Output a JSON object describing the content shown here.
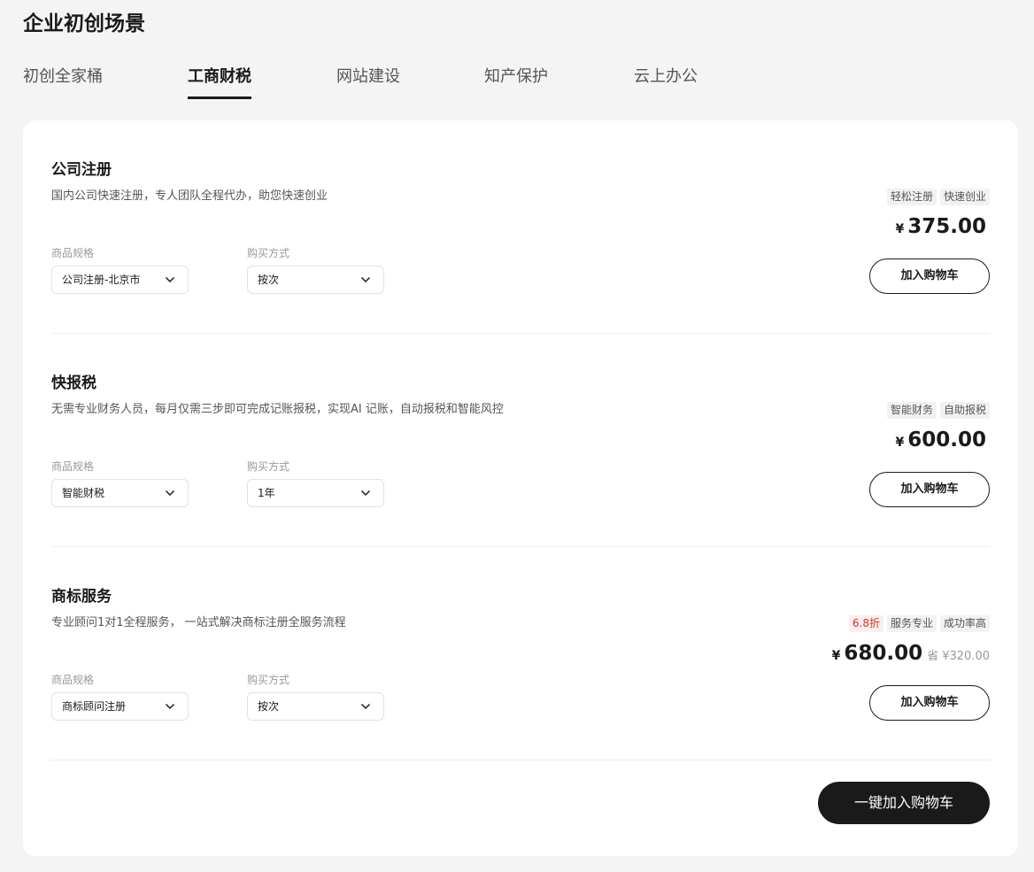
{
  "header": {
    "title": "企业初创场景"
  },
  "tabs": [
    {
      "label": "初创全家桶",
      "active": false
    },
    {
      "label": "工商财税",
      "active": true
    },
    {
      "label": "网站建设",
      "active": false
    },
    {
      "label": "知产保护",
      "active": false
    },
    {
      "label": "云上办公",
      "active": false
    }
  ],
  "products": [
    {
      "name": "公司注册",
      "description": "国内公司快速注册，专人团队全程代办，助您快速创业",
      "spec_label": "商品规格",
      "spec_value": "公司注册-北京市",
      "purchase_label": "购买方式",
      "purchase_value": "按次",
      "tags": [
        "轻松注册",
        "快速创业"
      ],
      "currency": "¥",
      "price": "375.00",
      "cart_label": "加入购物车"
    },
    {
      "name": "快报税",
      "description": "无需专业财务人员，每月仅需三步即可完成记账报税，实现AI 记账，自动报税和智能风控",
      "spec_label": "商品规格",
      "spec_value": "智能财税",
      "purchase_label": "购买方式",
      "purchase_value": "1年",
      "tags": [
        "智能财务",
        "自助报税"
      ],
      "currency": "¥",
      "price": "600.00",
      "cart_label": "加入购物车"
    },
    {
      "name": "商标服务",
      "description": "专业顾问1对1全程服务， 一站式解决商标注册全服务流程",
      "spec_label": "商品规格",
      "spec_value": "商标顾问注册",
      "purchase_label": "购买方式",
      "purchase_value": "按次",
      "discount_tag": "6.8折",
      "tags": [
        "服务专业",
        "成功率高"
      ],
      "currency": "¥",
      "price": "680.00",
      "save_text": "省 ¥320.00",
      "cart_label": "加入购物车"
    }
  ],
  "footer": {
    "one_click_label": "一键加入购物车"
  },
  "colors": {
    "accent": "#1a1a1a",
    "discount": "#d0342c",
    "background": "#f4f4f4"
  },
  "icons": {
    "select_arrow": "chevron-down-icon"
  }
}
